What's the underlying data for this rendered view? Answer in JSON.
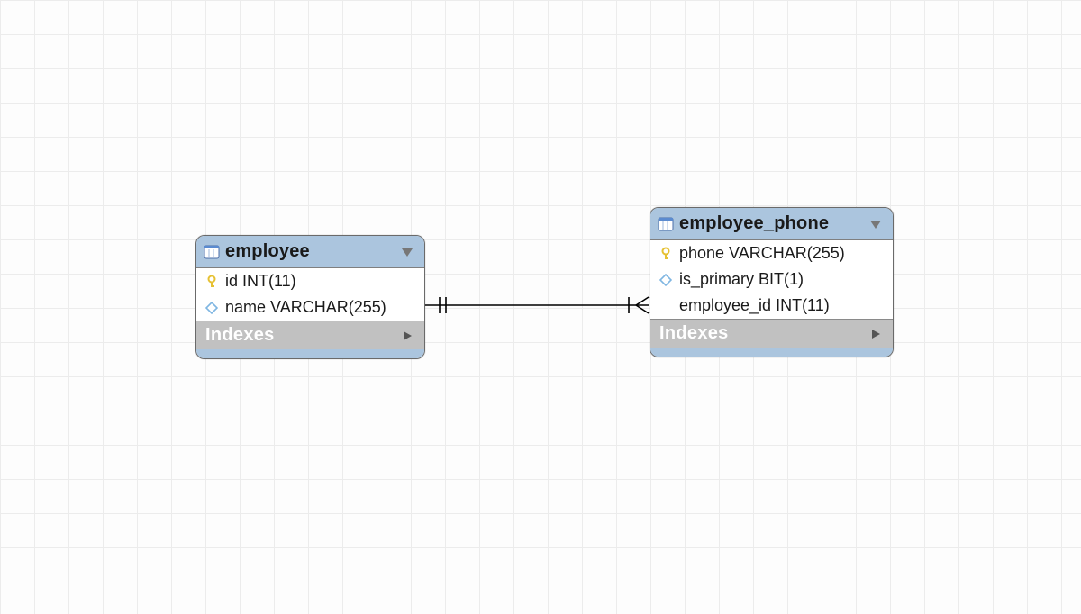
{
  "entities": {
    "employee": {
      "title": "employee",
      "fields": [
        {
          "icon": "key",
          "text": "id INT(11)"
        },
        {
          "icon": "diamond",
          "text": "name VARCHAR(255)"
        }
      ],
      "footer": "Indexes"
    },
    "employee_phone": {
      "title": "employee_phone",
      "fields": [
        {
          "icon": "key",
          "text": "phone VARCHAR(255)"
        },
        {
          "icon": "diamond",
          "text": "is_primary BIT(1)"
        },
        {
          "icon": "none",
          "text": "employee_id INT(11)"
        }
      ],
      "footer": "Indexes"
    }
  },
  "relationship": {
    "from": "employee",
    "to": "employee_phone",
    "from_cardinality": "one",
    "to_cardinality": "many"
  }
}
